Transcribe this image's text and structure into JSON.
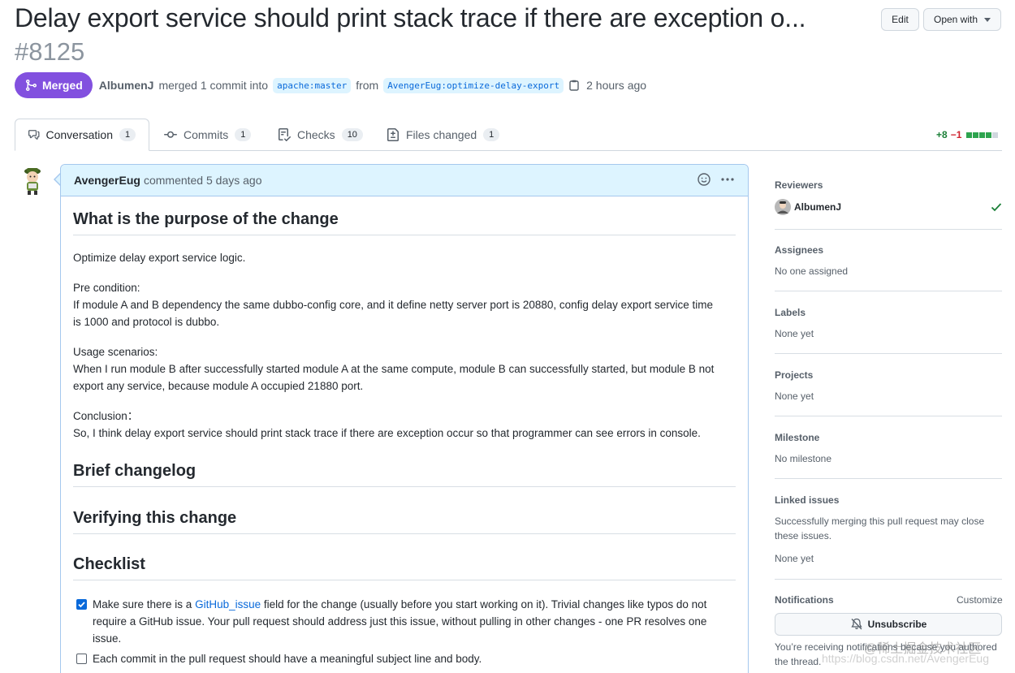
{
  "pr": {
    "title": "Delay export service should print stack trace if there are exception o...",
    "number": "#8125",
    "edit_label": "Edit",
    "open_with_label": "Open with",
    "status": "Merged",
    "merged_by": "AlbumenJ",
    "merge_text": "merged 1 commit into",
    "base_branch": "apache:master",
    "from_text": "from",
    "head_branch": "AvengerEug:optimize-delay-export",
    "time_ago": "2 hours ago"
  },
  "tabs": [
    {
      "label": "Conversation",
      "count": "1",
      "icon": "comment-discussion-icon"
    },
    {
      "label": "Commits",
      "count": "1",
      "icon": "git-commit-icon"
    },
    {
      "label": "Checks",
      "count": "10",
      "icon": "checklist-icon"
    },
    {
      "label": "Files changed",
      "count": "1",
      "icon": "file-diff-icon"
    }
  ],
  "diffstat": {
    "additions": "+8",
    "deletions": "−1",
    "add_color": "#2da44e",
    "neutral_color": "#d0d7de"
  },
  "comment": {
    "author": "AvengerEug",
    "meta": "commented 5 days ago",
    "h_purpose": "What is the purpose of the change",
    "p1": "Optimize delay export service logic.",
    "precondition_label": "Pre condition:",
    "precondition_text": "If module A and B dependency the same dubbo-config core, and it define netty server port is 20880, config delay export service time is 1000 and protocol is dubbo.",
    "usage_label": "Usage scenarios:",
    "usage_text": "When I run module B after successfully started module A at the same compute, module B can successfully started, but module B not export any service, because module A occupied 21880 port.",
    "conclusion_label": "Conclusion：",
    "conclusion_text": "So, I think delay export service should print stack trace if there are exception occur so that programmer can see errors in console.",
    "h_changelog": "Brief changelog",
    "h_verifying": "Verifying this change",
    "h_checklist": "Checklist",
    "check1_pre": "Make sure there is a ",
    "check1_link": "GitHub_issue",
    "check1_post": " field for the change (usually before you start working on it). Trivial changes like typos do not require a GitHub issue. Your pull request should address just this issue, without pulling in other changes - one PR resolves one issue.",
    "check1_checked": true,
    "check2": "Each commit in the pull request should have a meaningful subject line and body.",
    "check2_checked": false
  },
  "sidebar": {
    "reviewers_h": "Reviewers",
    "reviewer": "AlbumenJ",
    "assignees_h": "Assignees",
    "assignees_v": "No one assigned",
    "labels_h": "Labels",
    "labels_v": "None yet",
    "projects_h": "Projects",
    "projects_v": "None yet",
    "milestone_h": "Milestone",
    "milestone_v": "No milestone",
    "linked_h": "Linked issues",
    "linked_desc1": "Successfully merging this pull request may close",
    "linked_desc2": "these issues.",
    "linked_v": "None yet",
    "notifications_h": "Notifications",
    "customize": "Customize",
    "unsubscribe": "Unsubscribe",
    "notif_reason1": "You’re receiving notifications because you authored",
    "notif_reason2": "the thread."
  },
  "watermark": {
    "line1": "@稀土掘金技术社区",
    "line2": "https://blog.csdn.net/AvengerEug"
  }
}
